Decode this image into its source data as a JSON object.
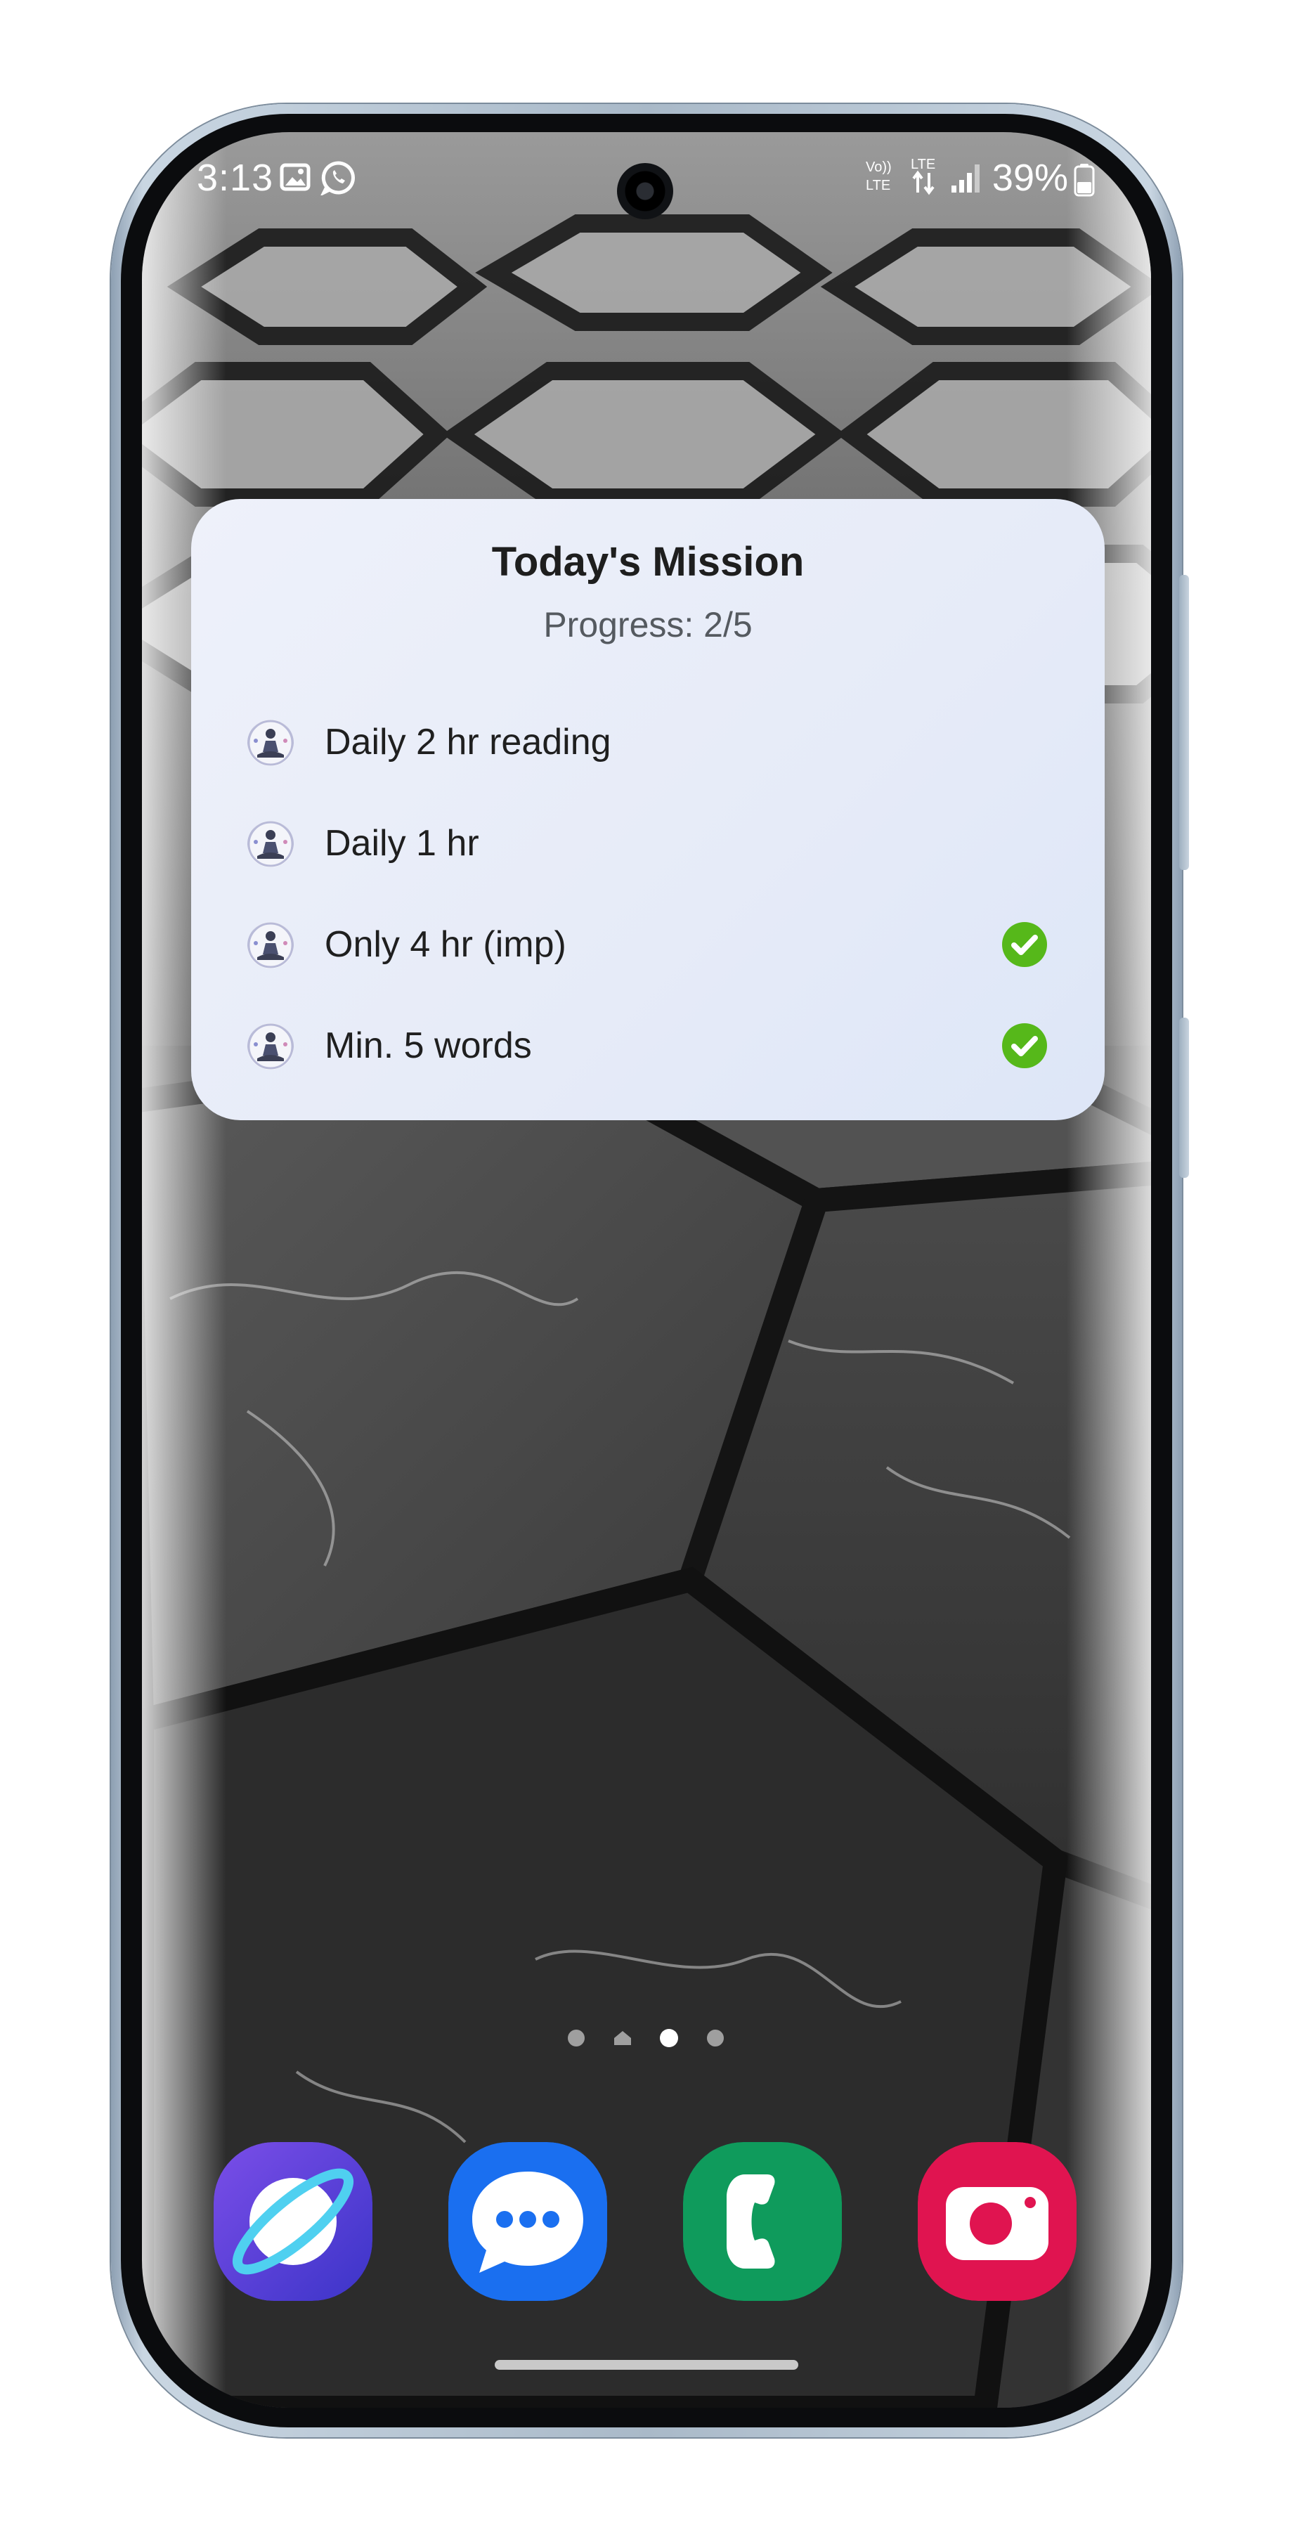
{
  "status_bar": {
    "time": "3:13",
    "network_label": "LTE",
    "battery": "39%"
  },
  "widget": {
    "title": "Today's Mission",
    "progress": "Progress: 2/5",
    "tasks": [
      {
        "label": "Daily 2 hr reading",
        "completed": false
      },
      {
        "label": "Daily 1 hr",
        "completed": false
      },
      {
        "label": "Only 4 hr (imp)",
        "completed": true
      },
      {
        "label": "Min. 5 words",
        "completed": true
      }
    ]
  },
  "home_pages": {
    "count": 4,
    "current_index": 2
  },
  "dock": {
    "apps": [
      {
        "name": "Internet",
        "icon": "internet-planet-icon",
        "color": "#5a3fd6"
      },
      {
        "name": "Messages",
        "icon": "messages-bubble-icon",
        "color": "#1a6ff0"
      },
      {
        "name": "Phone",
        "icon": "phone-handset-icon",
        "color": "#0f9b5c"
      },
      {
        "name": "Camera",
        "icon": "camera-icon",
        "color": "#e01450"
      }
    ]
  },
  "colors": {
    "check_green": "#56b81a",
    "widget_background": "#e8edf9"
  }
}
